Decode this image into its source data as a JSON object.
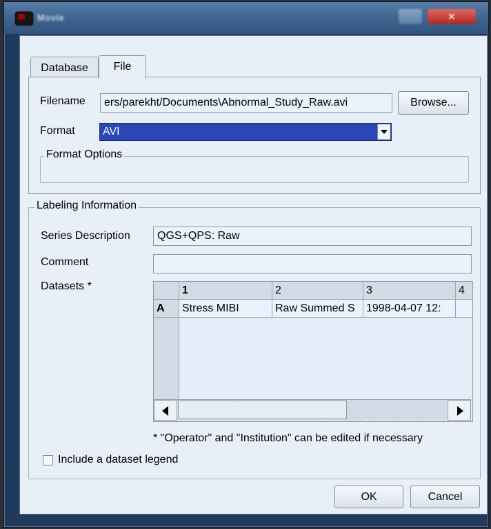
{
  "window": {
    "title": "Movie",
    "close_symbol": "✕"
  },
  "tabs": [
    {
      "label": "Database",
      "active": false
    },
    {
      "label": "File",
      "active": true
    }
  ],
  "file": {
    "filename_label": "Filename",
    "filename_value": "ers/parekht/Documents\\Abnormal_Study_Raw.avi",
    "browse_label": "Browse...",
    "format_label": "Format",
    "format_value": "AVI",
    "format_options_label": "Format Options"
  },
  "labeling": {
    "group_label": "Labeling Information",
    "series_description_label": "Series Description",
    "series_description_value": "QGS+QPS: Raw",
    "comment_label": "Comment",
    "comment_value": "",
    "datasets_label": "Datasets *",
    "table": {
      "columns": [
        "1",
        "2",
        "3",
        "4"
      ],
      "rows": [
        {
          "header": "A",
          "cells": [
            "Stress MIBI",
            "Raw Summed S",
            "1998-04-07 12:",
            ""
          ]
        }
      ]
    },
    "footnote": "* \"Operator\" and \"Institution\" can be edited if necessary",
    "legend_checkbox_label": "Include a dataset legend",
    "legend_checkbox_checked": false
  },
  "buttons": {
    "ok": "OK",
    "cancel": "Cancel"
  },
  "colors": {
    "title_bar": "#3d6591",
    "selection": "#2a47b8",
    "panel_bg": "#e9eff6",
    "close_button": "#c0392b"
  }
}
